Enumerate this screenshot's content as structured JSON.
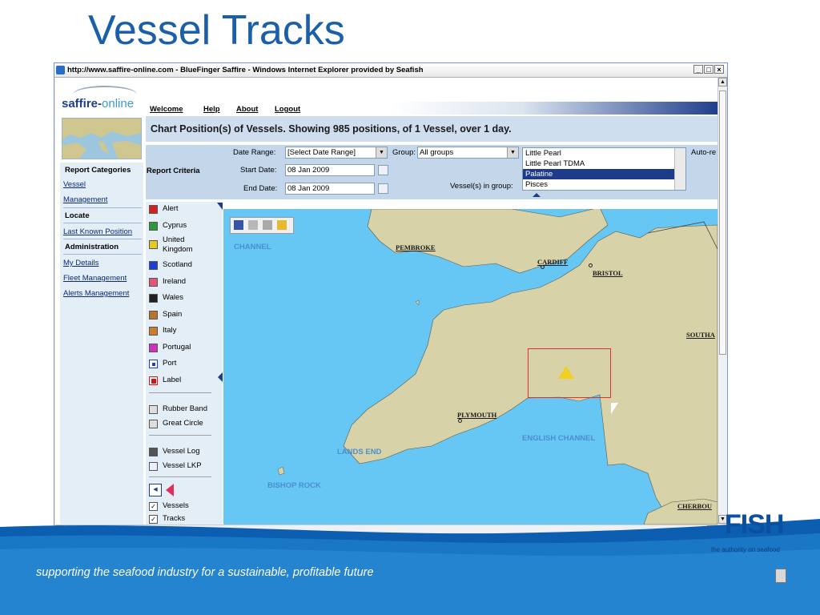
{
  "slide": {
    "title": "Vessel Tracks",
    "footer_text": "supporting the seafood industry for a sustainable, profitable future",
    "logo_text": "FISH",
    "logo_tagline": "the authority on seafood"
  },
  "browser": {
    "title": "http://www.saffire-online.com - BlueFinger Saffire - Windows Internet Explorer provided by Seafish",
    "minimize": "_",
    "maximize": "□",
    "close": "×"
  },
  "app": {
    "logo_main": "saffire-",
    "logo_accent": "online",
    "top_nav": [
      "Welcome",
      "Help",
      "About",
      "Logout"
    ],
    "chart_header": "Chart Position(s) of Vessels. Showing 985 positions, of 1 Vessel, over 1 day.",
    "auto_label": "Auto-re"
  },
  "sidebar": {
    "report_categories": "Report Categories",
    "vessel_management_1": "Vessel",
    "vessel_management_2": "Management",
    "locate": "Locate",
    "last_known_position": "Last Known Position",
    "administration": "Administration",
    "my_details": "My Details",
    "fleet_management": "Fleet Management",
    "alerts_management": "Alerts Management"
  },
  "criteria": {
    "heading": "Report Criteria",
    "date_range_label": "Date Range:",
    "date_range_value": "[Select Date Range]",
    "group_label": "Group:",
    "group_value": "All groups",
    "start_date_label": "Start Date:",
    "start_date_value": "08 Jan 2009",
    "end_date_label": "End Date:",
    "end_date_value": "08 Jan 2009",
    "vessels_in_group_label": "Vessel(s) in group:",
    "vessel_options": [
      "Little Pearl",
      "Little Pearl TDMA",
      "Palatine",
      "Pisces"
    ],
    "selected_vessel": "Palatine"
  },
  "legend": {
    "items": [
      {
        "label": "Alert",
        "color": "#d32020"
      },
      {
        "label": "Cyprus",
        "color": "#2a9a3a"
      },
      {
        "label": "United\nKingdom",
        "color": "#e6c81e"
      },
      {
        "label": "Scotland",
        "color": "#1c3fd0"
      },
      {
        "label": "Ireland",
        "color": "#e0557a"
      },
      {
        "label": "Wales",
        "color": "#202020"
      },
      {
        "label": "Spain",
        "color": "#b8742a"
      },
      {
        "label": "Italy",
        "color": "#c87e2a"
      },
      {
        "label": "Portugal",
        "color": "#d030c0"
      },
      {
        "label": "Port",
        "color": "#1c3fd0"
      },
      {
        "label": "Label",
        "color": "#d01818"
      }
    ],
    "tools": [
      "Rubber Band",
      "Great Circle"
    ],
    "logs": [
      "Vessel Log",
      "Vessel LKP"
    ],
    "checks": [
      "Vessels",
      "Tracks"
    ]
  },
  "map": {
    "places": [
      "PEMBROKE",
      "CARDIFF",
      "BRISTOL",
      "SOUTHA",
      "PLYMOUTH",
      "CHERBOU"
    ],
    "seas": [
      "CHANNEL",
      "ENGLISH CHANNEL",
      "LANDS END",
      "BISHOP ROCK"
    ],
    "colors": {
      "sea": "#66c7f5",
      "land": "#d8d2a8",
      "selection": "#e03030",
      "vessel": "#f0d020"
    }
  }
}
